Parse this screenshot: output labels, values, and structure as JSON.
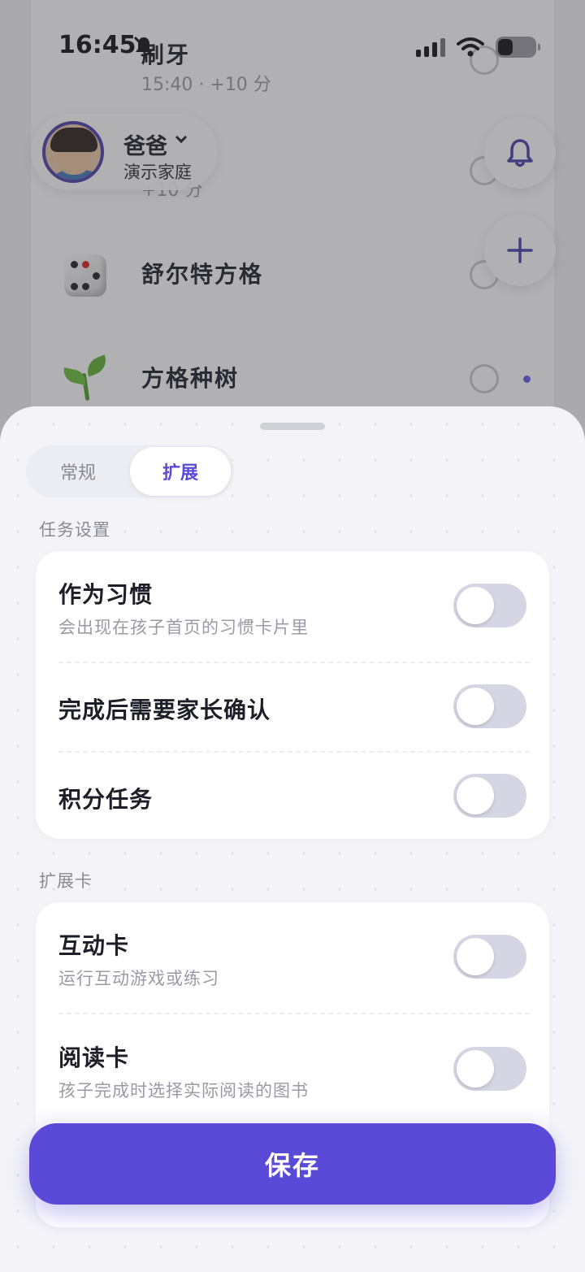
{
  "status_bar": {
    "time": "16:45"
  },
  "background": {
    "tasks": [
      {
        "name": "刷牙",
        "sub": "15:40 · +10 分"
      },
      {
        "name": "",
        "sub": "+10 分"
      },
      {
        "name": "舒尔特方格",
        "sub": ""
      },
      {
        "name": "方格种树",
        "sub": ""
      }
    ],
    "profile": {
      "name": "爸爸",
      "family": "演示家庭"
    }
  },
  "sheet": {
    "tabs": [
      {
        "label": "常规",
        "active": false
      },
      {
        "label": "扩展",
        "active": true
      }
    ],
    "task_settings": {
      "section_label": "任务设置",
      "items": [
        {
          "title": "作为习惯",
          "desc": "会出现在孩子首页的习惯卡片里",
          "enabled": false
        },
        {
          "title": "完成后需要家长确认",
          "desc": "",
          "enabled": false
        },
        {
          "title": "积分任务",
          "desc": "",
          "enabled": false
        }
      ]
    },
    "extension_cards": {
      "section_label": "扩展卡",
      "items": [
        {
          "title": "互动卡",
          "desc": "运行互动游戏或练习",
          "enabled": false
        },
        {
          "title": "阅读卡",
          "desc": "孩子完成时选择实际阅读的图书",
          "enabled": false
        }
      ]
    },
    "save_label": "保存"
  },
  "colors": {
    "accent": "#5a4ad8",
    "toggle_off": "#d6d5e4"
  }
}
